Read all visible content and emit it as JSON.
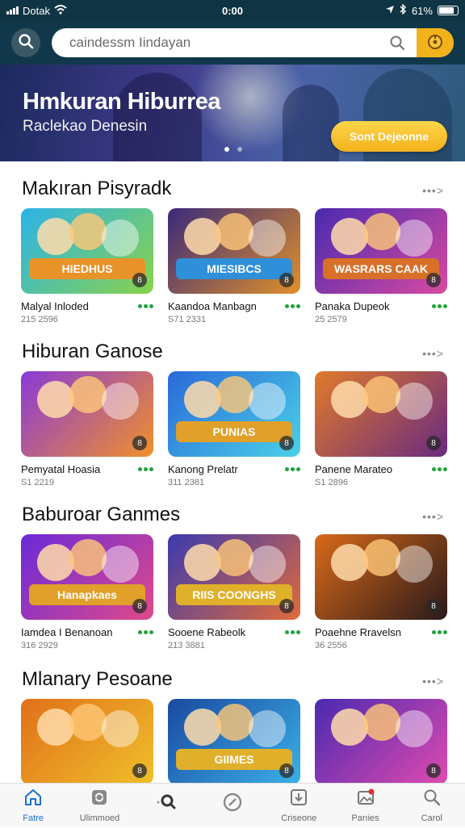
{
  "status": {
    "carrier": "Dotak",
    "time": "0:00",
    "battery": "61%"
  },
  "search": {
    "placeholder": "caindessm Iindayan"
  },
  "banner": {
    "title": "Hmkuran Hiburrea",
    "subtitle": "Raclekao Denesin",
    "cta": "Sont Dejeonne"
  },
  "sections": [
    {
      "title": "Makıran Pisyradk",
      "more": "•••>",
      "cards": [
        {
          "title": "Malyal Inloded",
          "sub": "215 2596",
          "logo": "HIEDHUS",
          "bg": [
            "#2bb3e8",
            "#8ad24a"
          ],
          "logo_color": "#e8932a"
        },
        {
          "title": "Kaandoa Manbagn",
          "sub": "S71 2331",
          "logo": "MIESIBCS",
          "bg": [
            "#3a2a7a",
            "#e0902a"
          ],
          "logo_color": "#2f8fd8"
        },
        {
          "title": "Panaka Dupeok",
          "sub": "25 2579",
          "logo": "WASRARS CAAK",
          "bg": [
            "#4a2ab0",
            "#d84aa0"
          ],
          "logo_color": "#d8702a"
        }
      ]
    },
    {
      "title": "Hiburan Ganose",
      "more": "•••>",
      "cards": [
        {
          "title": "Pemyatal Hoasia",
          "sub": "S1 2219",
          "logo": "",
          "bg": [
            "#8a3ad8",
            "#f0902a"
          ],
          "logo_color": "#c04ae0"
        },
        {
          "title": "Kanong Prelatr",
          "sub": "311 2381",
          "logo": "PUNIAS",
          "bg": [
            "#2a6ad8",
            "#4ad0e8"
          ],
          "logo_color": "#e0a02a"
        },
        {
          "title": "Panene Marateo",
          "sub": "S1 2896",
          "logo": "",
          "bg": [
            "#e07a2a",
            "#6a2a80"
          ],
          "logo_color": "#c06a2a"
        }
      ]
    },
    {
      "title": "Baburoar Ganmes",
      "more": "•••>",
      "cards": [
        {
          "title": "Iamdea I Benanoan",
          "sub": "316 2929",
          "logo": "Hanapkaes",
          "bg": [
            "#6a2ad8",
            "#e04a8a"
          ],
          "logo_color": "#e0a02a"
        },
        {
          "title": "Sooene Rabeolk",
          "sub": "213 3881",
          "logo": "RIIS COONGHS",
          "bg": [
            "#3a3ab0",
            "#e06a3a"
          ],
          "logo_color": "#e0b02a"
        },
        {
          "title": "Poaehne Rravelsn",
          "sub": "36 2556",
          "logo": "",
          "bg": [
            "#d86a1a",
            "#2a1a1a"
          ],
          "logo_color": "#a04a1a"
        }
      ]
    },
    {
      "title": "Mlanary Pesoane",
      "more": "•••>",
      "cards": [
        {
          "title": "",
          "sub": "",
          "logo": "",
          "bg": [
            "#e0701a",
            "#f0c02a"
          ],
          "logo_color": "#8a4a1a"
        },
        {
          "title": "",
          "sub": "",
          "logo": "GIIMES",
          "bg": [
            "#1a4aa0",
            "#3ab0e8"
          ],
          "logo_color": "#e0b02a"
        },
        {
          "title": "",
          "sub": "",
          "logo": "",
          "bg": [
            "#4a2ab0",
            "#e04ab0"
          ],
          "logo_color": "#e08a2a"
        }
      ]
    }
  ],
  "nav": [
    {
      "label": "Fatre",
      "icon": "home-icon"
    },
    {
      "label": "Ulimmoed",
      "icon": "refresh-icon"
    },
    {
      "label": "",
      "icon": "search-icon"
    },
    {
      "label": "",
      "icon": "compass-icon"
    },
    {
      "label": "Criseone",
      "icon": "download-icon"
    },
    {
      "label": "Parıies",
      "icon": "image-icon"
    },
    {
      "label": "Carol",
      "icon": "search-icon"
    }
  ]
}
